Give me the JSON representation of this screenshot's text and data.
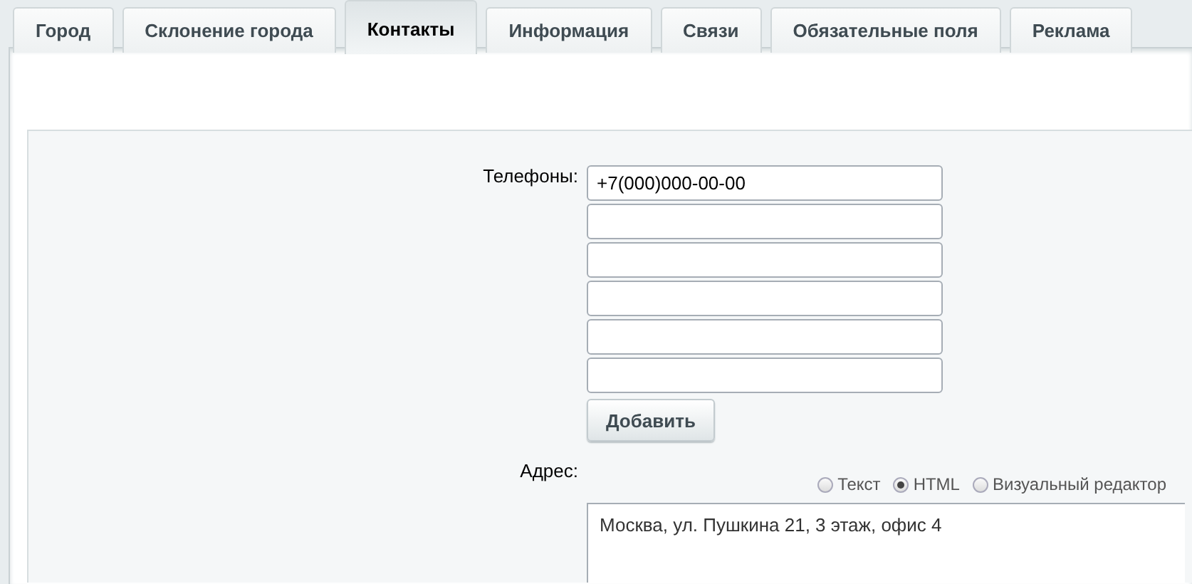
{
  "tabs": [
    {
      "label": "Город",
      "selected": false
    },
    {
      "label": "Склонение города",
      "selected": false
    },
    {
      "label": "Контакты",
      "selected": true
    },
    {
      "label": "Информация",
      "selected": false
    },
    {
      "label": "Связи",
      "selected": false
    },
    {
      "label": "Обязательные поля",
      "selected": false
    },
    {
      "label": "Реклама",
      "selected": false
    }
  ],
  "phones": {
    "label": "Телефоны:",
    "fields": [
      {
        "kind": "filled",
        "value": "+7(000)000-00-00"
      },
      {
        "kind": "blank"
      },
      {
        "kind": "blank"
      },
      {
        "kind": "blank"
      },
      {
        "kind": "blank"
      },
      {
        "kind": "blank"
      }
    ],
    "add_button": "Добавить"
  },
  "address": {
    "label": "Адрес:",
    "modes": [
      {
        "label": "Текст",
        "selected": false
      },
      {
        "label": "HTML",
        "selected": true
      },
      {
        "label": "Визуальный редактор",
        "selected": false
      }
    ],
    "value": "Москва, ул. Пушкина 21, 3 этаж, офис 4"
  }
}
